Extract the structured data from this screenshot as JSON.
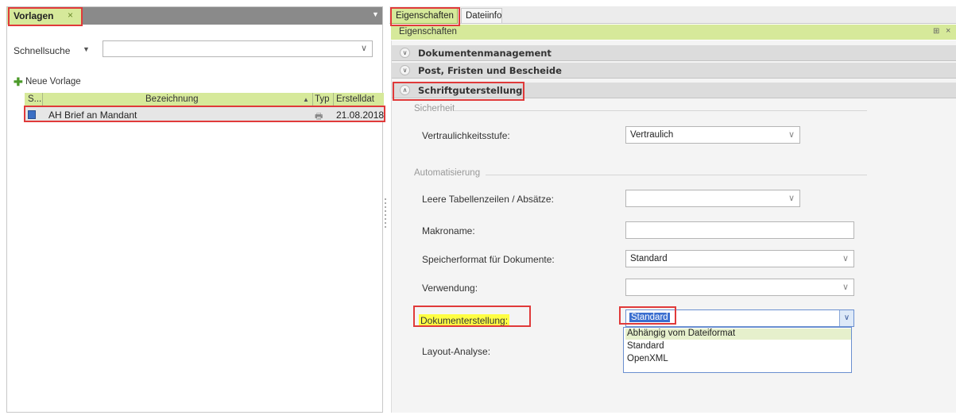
{
  "left": {
    "tab_label": "Vorlagen",
    "tab_close": "×",
    "header_arrow": "▼",
    "schnellsuche_label": "Schnellsuche",
    "schnellsuche_arrow": "▼",
    "schnellsuche_value": "",
    "new_template_icon": "✚",
    "new_template_label": "Neue Vorlage",
    "columns": [
      "S...",
      "Bezeichnung",
      "Typ",
      "Erstelldat"
    ],
    "sort_indicator": "▲",
    "rows": [
      {
        "name": "AH Brief an Mandant",
        "date": "21.08.2018"
      }
    ]
  },
  "right": {
    "tabs": [
      "Eigenschaften",
      "Dateiinfo"
    ],
    "panel_title": "Eigenschaften",
    "pin_glyph": "⊞",
    "close_glyph": "×",
    "categories": [
      "Dokumentenmanagement",
      "Post, Fristen und Bescheide",
      "Schriftguterstellung"
    ],
    "groups": {
      "sicherheit": "Sicherheit",
      "automatisierung": "Automatisierung"
    },
    "fields": {
      "vertraulichkeit_label": "Vertraulichkeitsstufe:",
      "vertraulichkeit_value": "Vertraulich",
      "leere_label": "Leere Tabellenzeilen / Absätze:",
      "leere_value": "",
      "makroname_label": "Makroname:",
      "makroname_value": "",
      "speicherformat_label": "Speicherformat für Dokumente:",
      "speicherformat_value": "Standard",
      "verwendung_label": "Verwendung:",
      "verwendung_value": "",
      "dokumenterstellung_label": "Dokumenterstellung:",
      "dokumenterstellung_value": "Standard",
      "layout_label": "Layout-Analyse:"
    },
    "dropdown_options": [
      "Abhängig vom Dateiformat",
      "Standard",
      "OpenXML"
    ]
  },
  "colors": {
    "accent_green": "#d6e99a",
    "highlight_red": "#e03a3a",
    "selection_blue": "#3b6fd0"
  }
}
